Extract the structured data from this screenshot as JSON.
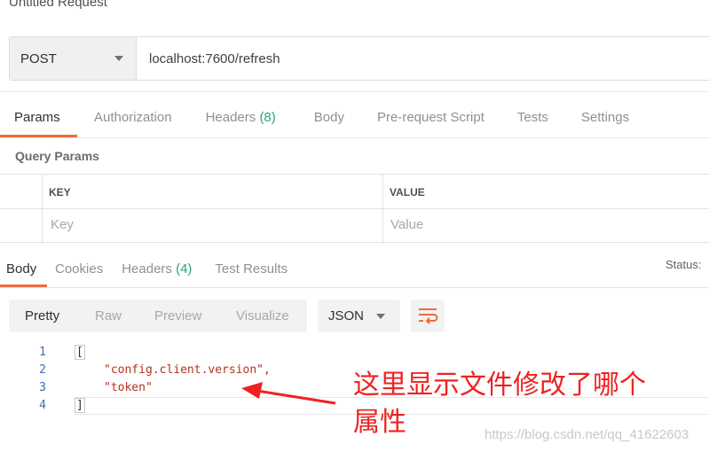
{
  "request": {
    "title": "Untitled Request",
    "method": "POST",
    "url": "localhost:7600/refresh"
  },
  "request_tabs": [
    {
      "label": "Params",
      "count": ""
    },
    {
      "label": "Authorization",
      "count": ""
    },
    {
      "label": "Headers",
      "count": "(8)"
    },
    {
      "label": "Body",
      "count": ""
    },
    {
      "label": "Pre-request Script",
      "count": ""
    },
    {
      "label": "Tests",
      "count": ""
    },
    {
      "label": "Settings",
      "count": ""
    }
  ],
  "query_params": {
    "label": "Query Params",
    "col_key": "KEY",
    "col_value": "VALUE",
    "key_placeholder": "Key",
    "value_placeholder": "Value"
  },
  "response_tabs": [
    {
      "label": "Body",
      "count": ""
    },
    {
      "label": "Cookies",
      "count": ""
    },
    {
      "label": "Headers",
      "count": "(4)"
    },
    {
      "label": "Test Results",
      "count": ""
    }
  ],
  "status_label": "Status:",
  "view_modes": [
    "Pretty",
    "Raw",
    "Preview",
    "Visualize"
  ],
  "format": "JSON",
  "code_lines": [
    {
      "num": "1",
      "text": "["
    },
    {
      "num": "2",
      "text": "\"config.client.version\","
    },
    {
      "num": "3",
      "text": "\"token\""
    },
    {
      "num": "4",
      "text": "]"
    }
  ],
  "annotation": {
    "line1": "这里显示文件修改了哪个",
    "line2": "属性"
  },
  "watermark": "https://blog.csdn.net/qq_41622603",
  "colors": {
    "accent": "#f26b3a",
    "count_green": "#2aa27b",
    "annotation_red": "#ee2222",
    "string": "#b4321e",
    "line_number": "#3a6fb0"
  },
  "icons": [
    "method-dropdown-caret-icon",
    "format-dropdown-caret-icon",
    "wrap-lines-icon",
    "annotation-arrow-icon"
  ]
}
